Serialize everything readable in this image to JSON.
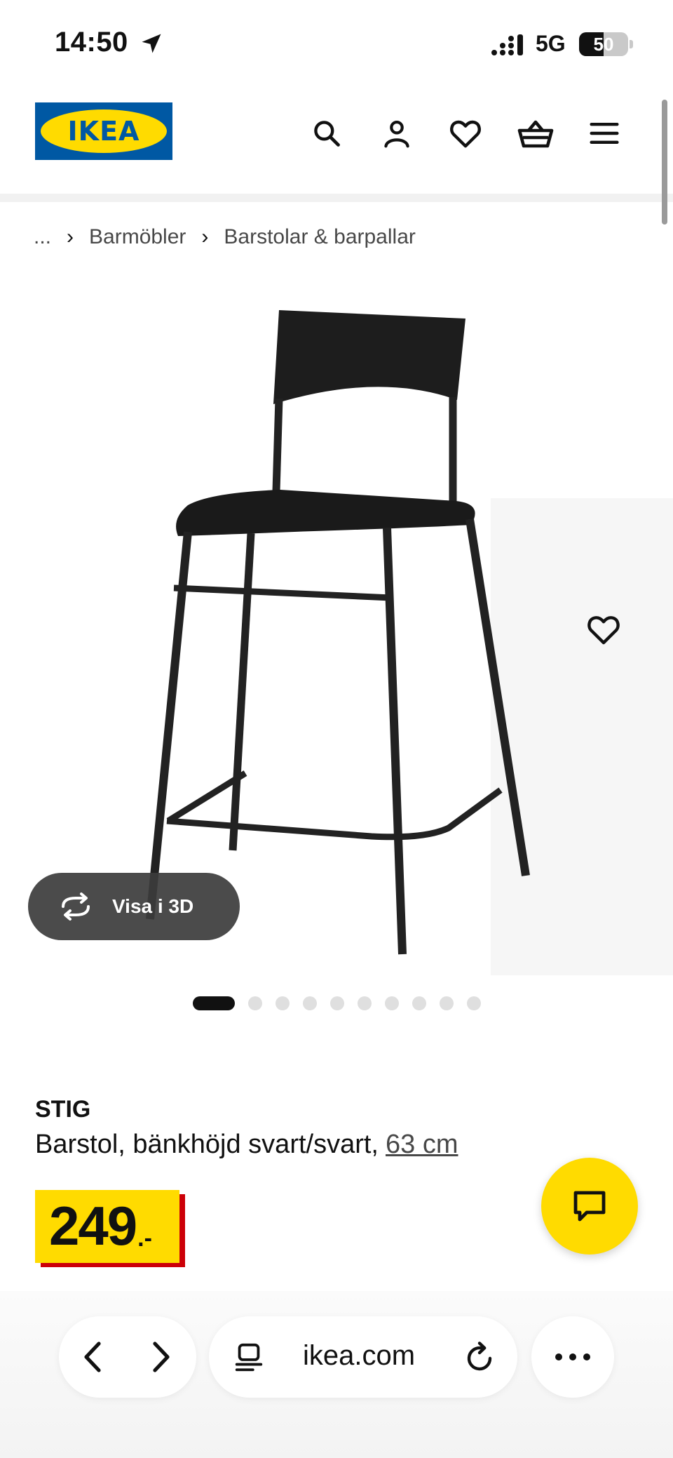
{
  "status_bar": {
    "time": "14:50",
    "network": "5G",
    "battery": "50",
    "battery_level": 0.5
  },
  "header": {
    "logo_text": "IKEA",
    "icons": [
      "search-icon",
      "account-icon",
      "favorites-icon",
      "cart-icon",
      "menu-icon"
    ]
  },
  "breadcrumb": {
    "ellipsis": "...",
    "items": [
      "Barmöbler",
      "Barstolar & barpallar"
    ]
  },
  "gallery": {
    "view_3d_label": "Visa i 3D",
    "image_count": 10,
    "active_index": 0
  },
  "product": {
    "name": "STIG",
    "description": "Barstol, bänkhöjd svart/svart,",
    "size_link": "63 cm",
    "price": "249",
    "price_suffix": ".-"
  },
  "browser": {
    "url": "ikea.com"
  },
  "colors": {
    "ikea_blue": "#0058a3",
    "ikea_yellow": "#ffdb00",
    "price_red": "#cc0008",
    "text": "#111111"
  }
}
